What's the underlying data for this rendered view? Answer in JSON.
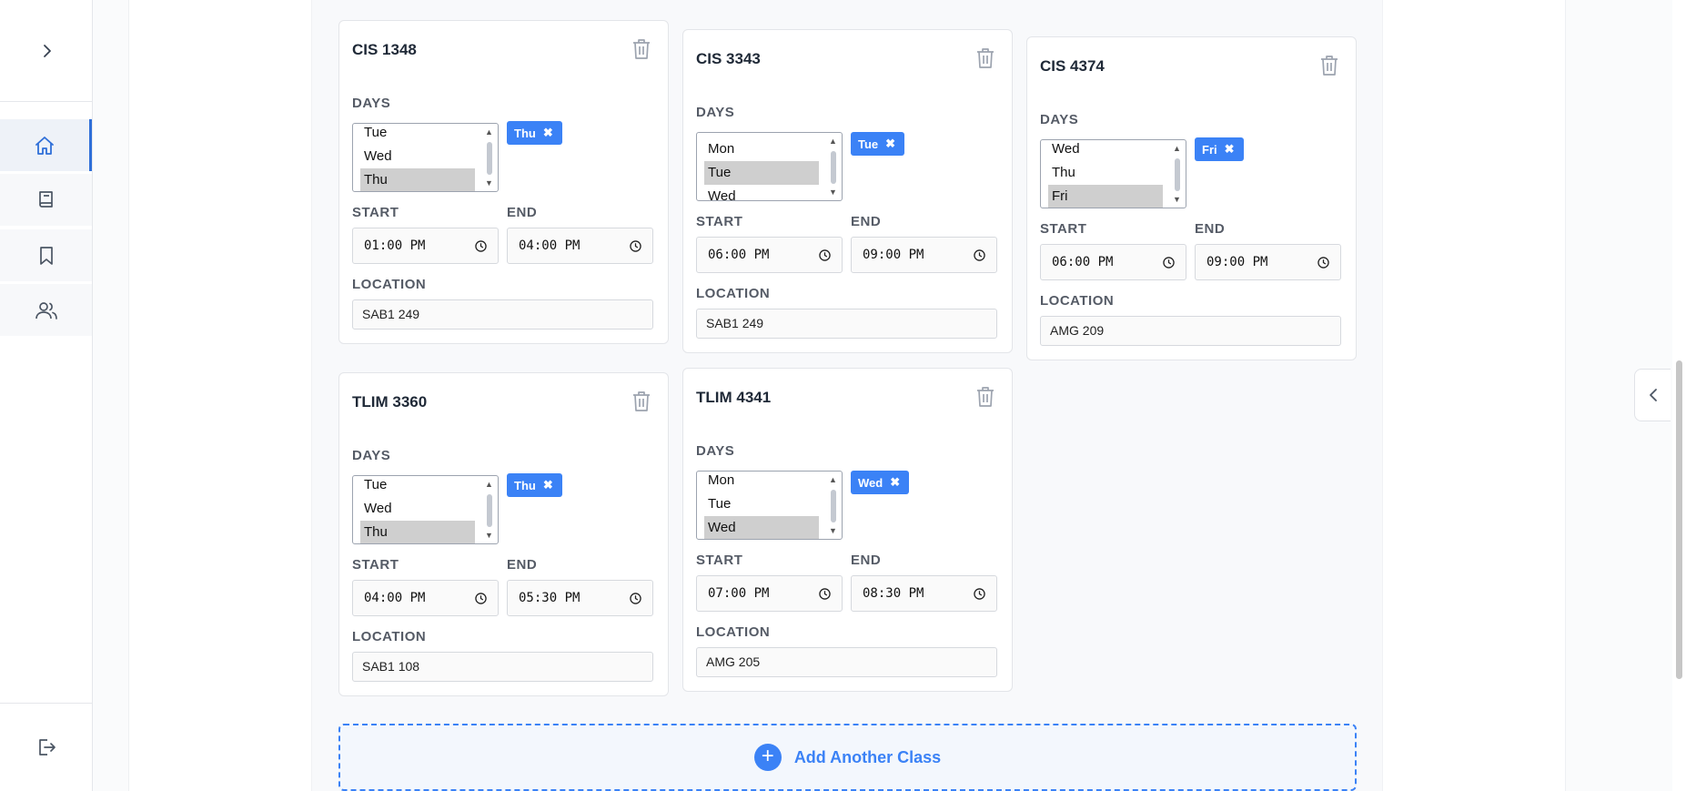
{
  "classes": [
    {
      "title": "CIS 1348",
      "days_label": "DAYS",
      "day_options": [
        "Tue",
        "Wed",
        "Thu"
      ],
      "selected_day": "Thu",
      "chip": "Thu",
      "start_label": "START",
      "end_label": "END",
      "start": "01:00 PM",
      "end": "04:00 PM",
      "location_label": "LOCATION",
      "location": "SAB1 249"
    },
    {
      "title": "CIS 3343",
      "days_label": "DAYS",
      "day_options": [
        "Mon",
        "Tue",
        "Wed"
      ],
      "selected_day": "Tue",
      "chip": "Tue",
      "start_label": "START",
      "end_label": "END",
      "start": "06:00 PM",
      "end": "09:00 PM",
      "location_label": "LOCATION",
      "location": "SAB1 249"
    },
    {
      "title": "CIS 4374",
      "days_label": "DAYS",
      "day_options": [
        "Wed",
        "Thu",
        "Fri"
      ],
      "selected_day": "Fri",
      "chip": "Fri",
      "start_label": "START",
      "end_label": "END",
      "start": "06:00 PM",
      "end": "09:00 PM",
      "location_label": "LOCATION",
      "location": "AMG 209"
    },
    {
      "title": "TLIM 3360",
      "days_label": "DAYS",
      "day_options": [
        "Tue",
        "Wed",
        "Thu"
      ],
      "selected_day": "Thu",
      "chip": "Thu",
      "start_label": "START",
      "end_label": "END",
      "start": "04:00 PM",
      "end": "05:30 PM",
      "location_label": "LOCATION",
      "location": "SAB1 108"
    },
    {
      "title": "TLIM 4341",
      "days_label": "DAYS",
      "day_options": [
        "Mon",
        "Tue",
        "Wed"
      ],
      "selected_day": "Wed",
      "chip": "Wed",
      "start_label": "START",
      "end_label": "END",
      "start": "07:00 PM",
      "end": "08:30 PM",
      "location_label": "LOCATION",
      "location": "AMG 205"
    }
  ],
  "add_button": {
    "label": "Add Another Class",
    "icon": "plus-circle-icon"
  },
  "sidebar": {
    "items": [
      {
        "icon": "home-icon",
        "active": true
      },
      {
        "icon": "book-icon",
        "active": false
      },
      {
        "icon": "bookmark-icon",
        "active": false
      },
      {
        "icon": "users-icon",
        "active": false
      }
    ],
    "expand_icon": "chevron-right-icon",
    "logout_icon": "logout-icon"
  },
  "colors": {
    "accent": "#3b82f6",
    "active_nav": "#2f6fd8"
  }
}
